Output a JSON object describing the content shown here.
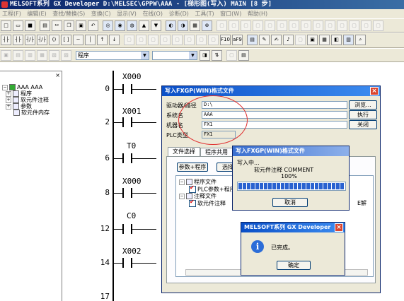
{
  "window": {
    "title": "MELSOFT系列 GX Developer D:\\MELSEC\\GPPW\\AAA - [梯形图(写入)      MAIN    [8 步]"
  },
  "menu": [
    "工程(F)",
    "编辑(E)",
    "查找/替换(S)",
    "变换(C)",
    "显示(V)",
    "在线(O)",
    "诊断(D)",
    "工具(T)",
    "窗口(W)",
    "帮助(H)"
  ],
  "toolbar": {
    "program_select": "程序"
  },
  "tree": {
    "close": "×",
    "root": "AAA AAA",
    "items": [
      "程序",
      "软元件注释",
      "参数",
      "软元件内存"
    ]
  },
  "ladder": {
    "rungs": [
      {
        "step": "0",
        "device": "X000"
      },
      {
        "step": "2",
        "device": "X001"
      },
      {
        "step": "6",
        "device": "T0"
      },
      {
        "step": "8",
        "device": "X000"
      },
      {
        "step": "12",
        "device": "C0"
      },
      {
        "step": "14",
        "device": "X002"
      },
      {
        "step": "17",
        "device": ""
      }
    ]
  },
  "dialog_write": {
    "title": "写入FXGP(WIN)格式文件",
    "close": "×",
    "labels": {
      "drive_path": "驱动器/路径",
      "system_name": "系统名",
      "machine_name": "机器名",
      "plc_type": "PLC类型"
    },
    "values": {
      "drive_path": "D:\\",
      "system_name": "AAA",
      "machine_name": "FX1",
      "plc_type": "FX1"
    },
    "buttons": {
      "browse": "浏览...",
      "execute": "执行",
      "close": "关闭",
      "param_program": "参数+程序",
      "select_all": "选择所"
    },
    "tabs": [
      "文件选择",
      "程序共用"
    ],
    "file_tree": {
      "program_files": "程序文件",
      "plc_param_program": "PLC参数+程序",
      "comment_files": "注释文件",
      "device_comment": "软元件注释",
      "suffix": "E解"
    }
  },
  "dialog_progress": {
    "title": "写入FXGP(WIN)格式文件",
    "writing": "写入中...",
    "item": "软元件注释  COMMENT",
    "percent": "100%",
    "progress": 1.0,
    "cancel": "取消"
  },
  "dialog_done": {
    "title": "MELSOFT系列 GX Developer",
    "close": "×",
    "icon": "i",
    "message": "已完成。",
    "ok": "确定"
  },
  "colors": {
    "title_bar": "#0a246a",
    "dialog_title": "#0a4fc7",
    "highlight_ellipse": "#e03030",
    "progress": "#2a62d0"
  }
}
